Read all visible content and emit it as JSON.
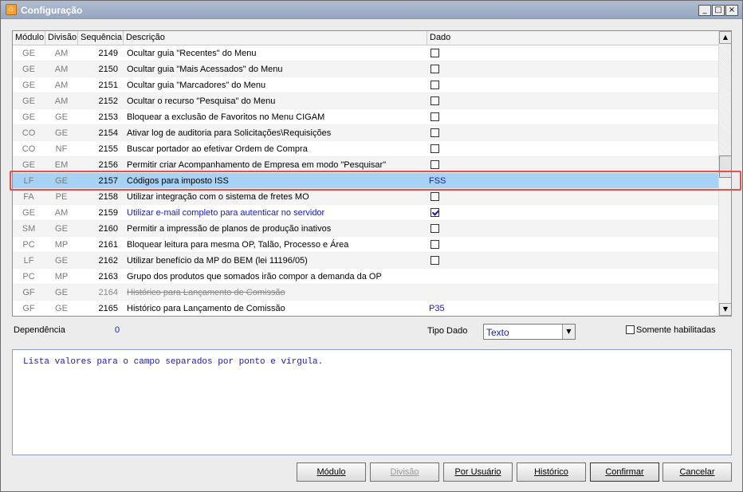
{
  "window": {
    "title": "Configuração",
    "app_icon": "app-home-icon",
    "controls": {
      "minimize": "_",
      "maximize": "□",
      "close": "×"
    }
  },
  "grid": {
    "columns": [
      "Módulo",
      "Divisão",
      "Sequência",
      "Descrição",
      "Dado"
    ],
    "rows": [
      {
        "modulo": "GE",
        "divisao": "AM",
        "seq": "2149",
        "desc": "Ocultar guia \"Recentes\" do Menu",
        "dado_type": "checkbox",
        "checked": false,
        "value": ""
      },
      {
        "modulo": "GE",
        "divisao": "AM",
        "seq": "2150",
        "desc": "Ocultar guia \"Mais Acessados\" do Menu",
        "dado_type": "checkbox",
        "checked": false,
        "value": ""
      },
      {
        "modulo": "GE",
        "divisao": "AM",
        "seq": "2151",
        "desc": "Ocultar guia \"Marcadores\" do Menu",
        "dado_type": "checkbox",
        "checked": false,
        "value": ""
      },
      {
        "modulo": "GE",
        "divisao": "AM",
        "seq": "2152",
        "desc": "Ocultar o recurso \"Pesquisa\" do Menu",
        "dado_type": "checkbox",
        "checked": false,
        "value": ""
      },
      {
        "modulo": "GE",
        "divisao": "GE",
        "seq": "2153",
        "desc": "Bloquear a exclusão de Favoritos no Menu CIGAM",
        "dado_type": "checkbox",
        "checked": false,
        "value": ""
      },
      {
        "modulo": "CO",
        "divisao": "GE",
        "seq": "2154",
        "desc": "Ativar log de auditoria para Solicitações\\Requisições",
        "dado_type": "checkbox",
        "checked": false,
        "value": ""
      },
      {
        "modulo": "CO",
        "divisao": "NF",
        "seq": "2155",
        "desc": "Buscar portador ao efetivar Ordem de Compra",
        "dado_type": "checkbox",
        "checked": false,
        "value": ""
      },
      {
        "modulo": "GE",
        "divisao": "EM",
        "seq": "2156",
        "desc": "Permitir criar Acompanhamento de Empresa em modo \"Pesquisar\"",
        "dado_type": "checkbox",
        "checked": false,
        "value": ""
      },
      {
        "modulo": "LF",
        "divisao": "GE",
        "seq": "2157",
        "desc": "Códigos para imposto ISS",
        "dado_type": "text",
        "checked": false,
        "value": "FSS",
        "selected": true
      },
      {
        "modulo": "FA",
        "divisao": "PE",
        "seq": "2158",
        "desc": "Utilizar integração com o sistema de fretes MO",
        "dado_type": "checkbox",
        "checked": false,
        "value": ""
      },
      {
        "modulo": "GE",
        "divisao": "AM",
        "seq": "2159",
        "desc": "Utilizar e-mail completo para autenticar no servidor",
        "dado_type": "checkbox",
        "checked": true,
        "value": "",
        "blue": true
      },
      {
        "modulo": "SM",
        "divisao": "GE",
        "seq": "2160",
        "desc": "Permitir a impressão de planos de produção inativos",
        "dado_type": "checkbox",
        "checked": false,
        "value": ""
      },
      {
        "modulo": "PC",
        "divisao": "MP",
        "seq": "2161",
        "desc": "Bloquear leitura para mesma OP, Talão, Processo e Área",
        "dado_type": "checkbox",
        "checked": false,
        "value": ""
      },
      {
        "modulo": "LF",
        "divisao": "GE",
        "seq": "2162",
        "desc": "Utilizar benefício da MP do BEM (lei 11196/05)",
        "dado_type": "checkbox",
        "checked": false,
        "value": ""
      },
      {
        "modulo": "PC",
        "divisao": "MP",
        "seq": "2163",
        "desc": "Grupo dos produtos que somados irão compor a demanda da OP",
        "dado_type": "text",
        "checked": false,
        "value": ""
      },
      {
        "modulo": "GF",
        "divisao": "GE",
        "seq": "2164",
        "desc": "Histórico para Lançamento de Comissão",
        "dado_type": "text",
        "checked": false,
        "value": "",
        "strike": true
      },
      {
        "modulo": "GF",
        "divisao": "GE",
        "seq": "2165",
        "desc": "Histórico para Lançamento de Comissão",
        "dado_type": "text",
        "checked": false,
        "value": "P35"
      }
    ],
    "scroll_fraction": 0.47
  },
  "details": {
    "dependencia_label": "Dependência",
    "dependencia_value": "0",
    "tipo_dado_label": "Tipo Dado",
    "tipo_dado_value": "Texto",
    "somente_label": "Somente habilitadas",
    "somente_checked": false
  },
  "help_text": "Lista valores para o campo separados por ponto e vírgula.",
  "buttons": {
    "modulo": "Módulo",
    "divisao": "Divisão",
    "por_usuario": "Por Usuário",
    "historico": "Histórico",
    "confirmar": "Confirmar",
    "cancelar": "Cancelar"
  },
  "colors": {
    "selection": "#a8d2f4",
    "highlight_outline": "#e05050",
    "value_text": "#1a1ab0"
  }
}
